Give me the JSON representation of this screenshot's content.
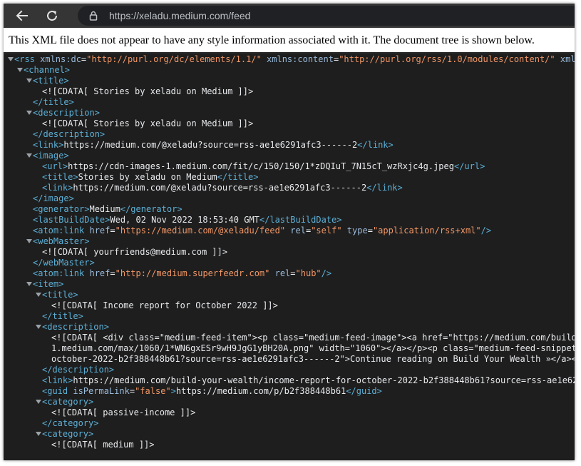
{
  "browser": {
    "url": "https://xeladu.medium.com/feed",
    "back_icon": "arrow-left",
    "reload_icon": "reload",
    "lock_icon": "lock"
  },
  "infobar": {
    "message": "This XML file does not appear to have any style information associated with it. The document tree is shown below."
  },
  "colors": {
    "tag": "#5db0d7",
    "attr_name": "#9bbbdc",
    "attr_value": "#f29766",
    "text": "#e8eaed",
    "background": "#1e1e1e"
  },
  "xml_lines": [
    {
      "indent": 0,
      "toggle": true,
      "segments": [
        [
          "tag",
          "<rss "
        ],
        [
          "attr",
          "xmlns:dc"
        ],
        [
          "text",
          "="
        ],
        [
          "val",
          "\"http://purl.org/dc/elements/1.1/\""
        ],
        [
          "text",
          " "
        ],
        [
          "attr",
          "xmlns:content"
        ],
        [
          "text",
          "="
        ],
        [
          "val",
          "\"http://purl.org/rss/1.0/modules/content/\""
        ],
        [
          "text",
          " "
        ],
        [
          "attr",
          "xmlns:atom"
        ]
      ]
    },
    {
      "indent": 1,
      "toggle": true,
      "segments": [
        [
          "tag",
          "<channel>"
        ]
      ]
    },
    {
      "indent": 2,
      "toggle": true,
      "segments": [
        [
          "tag",
          "<title>"
        ]
      ]
    },
    {
      "indent": 3,
      "toggle": false,
      "segments": [
        [
          "text",
          "<![CDATA[ Stories by xeladu on Medium ]]>"
        ]
      ]
    },
    {
      "indent": 2,
      "toggle": false,
      "segments": [
        [
          "tag",
          "</title>"
        ]
      ]
    },
    {
      "indent": 2,
      "toggle": true,
      "segments": [
        [
          "tag",
          "<description>"
        ]
      ]
    },
    {
      "indent": 3,
      "toggle": false,
      "segments": [
        [
          "text",
          "<![CDATA[ Stories by xeladu on Medium ]]>"
        ]
      ]
    },
    {
      "indent": 2,
      "toggle": false,
      "segments": [
        [
          "tag",
          "</description>"
        ]
      ]
    },
    {
      "indent": 2,
      "toggle": false,
      "segments": [
        [
          "tag",
          "<link>"
        ],
        [
          "text",
          "https://medium.com/@xeladu?source=rss-ae1e6291afc3------2"
        ],
        [
          "tag",
          "</link>"
        ]
      ]
    },
    {
      "indent": 2,
      "toggle": true,
      "segments": [
        [
          "tag",
          "<image>"
        ]
      ]
    },
    {
      "indent": 3,
      "toggle": false,
      "segments": [
        [
          "tag",
          "<url>"
        ],
        [
          "text",
          "https://cdn-images-1.medium.com/fit/c/150/150/1*zDQIuT_7N15cT_wzRxjc4g.jpeg"
        ],
        [
          "tag",
          "</url>"
        ]
      ]
    },
    {
      "indent": 3,
      "toggle": false,
      "segments": [
        [
          "tag",
          "<title>"
        ],
        [
          "text",
          "Stories by xeladu on Medium"
        ],
        [
          "tag",
          "</title>"
        ]
      ]
    },
    {
      "indent": 3,
      "toggle": false,
      "segments": [
        [
          "tag",
          "<link>"
        ],
        [
          "text",
          "https://medium.com/@xeladu?source=rss-ae1e6291afc3------2"
        ],
        [
          "tag",
          "</link>"
        ]
      ]
    },
    {
      "indent": 2,
      "toggle": false,
      "segments": [
        [
          "tag",
          "</image>"
        ]
      ]
    },
    {
      "indent": 2,
      "toggle": false,
      "segments": [
        [
          "tag",
          "<generator>"
        ],
        [
          "text",
          "Medium"
        ],
        [
          "tag",
          "</generator>"
        ]
      ]
    },
    {
      "indent": 2,
      "toggle": false,
      "segments": [
        [
          "tag",
          "<lastBuildDate>"
        ],
        [
          "text",
          "Wed, 02 Nov 2022 18:53:40 GMT"
        ],
        [
          "tag",
          "</lastBuildDate>"
        ]
      ]
    },
    {
      "indent": 2,
      "toggle": false,
      "segments": [
        [
          "tag",
          "<atom:link "
        ],
        [
          "attr",
          "href"
        ],
        [
          "text",
          "="
        ],
        [
          "val",
          "\"https://medium.com/@xeladu/feed\""
        ],
        [
          "text",
          " "
        ],
        [
          "attr",
          "rel"
        ],
        [
          "text",
          "="
        ],
        [
          "val",
          "\"self\""
        ],
        [
          "text",
          " "
        ],
        [
          "attr",
          "type"
        ],
        [
          "text",
          "="
        ],
        [
          "val",
          "\"application/rss+xml\""
        ],
        [
          "tag",
          "/>"
        ]
      ]
    },
    {
      "indent": 2,
      "toggle": true,
      "segments": [
        [
          "tag",
          "<webMaster>"
        ]
      ]
    },
    {
      "indent": 3,
      "toggle": false,
      "segments": [
        [
          "text",
          "<![CDATA[ yourfriends@medium.com ]]>"
        ]
      ]
    },
    {
      "indent": 2,
      "toggle": false,
      "segments": [
        [
          "tag",
          "</webMaster>"
        ]
      ]
    },
    {
      "indent": 2,
      "toggle": false,
      "segments": [
        [
          "tag",
          "<atom:link "
        ],
        [
          "attr",
          "href"
        ],
        [
          "text",
          "="
        ],
        [
          "val",
          "\"http://medium.superfeedr.com\""
        ],
        [
          "text",
          " "
        ],
        [
          "attr",
          "rel"
        ],
        [
          "text",
          "="
        ],
        [
          "val",
          "\"hub\""
        ],
        [
          "tag",
          "/>"
        ]
      ]
    },
    {
      "indent": 2,
      "toggle": true,
      "segments": [
        [
          "tag",
          "<item>"
        ]
      ]
    },
    {
      "indent": 3,
      "toggle": true,
      "segments": [
        [
          "tag",
          "<title>"
        ]
      ]
    },
    {
      "indent": 4,
      "toggle": false,
      "segments": [
        [
          "text",
          "<![CDATA[ Income report for October 2022 ]]>"
        ]
      ]
    },
    {
      "indent": 3,
      "toggle": false,
      "segments": [
        [
          "tag",
          "</title>"
        ]
      ]
    },
    {
      "indent": 3,
      "toggle": true,
      "segments": [
        [
          "tag",
          "<description>"
        ]
      ]
    },
    {
      "indent": 4,
      "toggle": false,
      "segments": [
        [
          "text",
          "<![CDATA[ <div class=\"medium-feed-item\"><p class=\"medium-feed-image\"><a href=\"https://medium.com/build-"
        ]
      ]
    },
    {
      "indent": 4,
      "toggle": false,
      "segments": [
        [
          "text",
          "1.medium.com/max/1060/1*WN6gxESr9wH9JgG1yBH20A.png\" width=\"1060\"></a></p><p class=\"medium-feed-snippet\""
        ]
      ]
    },
    {
      "indent": 4,
      "toggle": false,
      "segments": [
        [
          "text",
          "october-2022-b2f388448b61?source=rss-ae1e6291afc3------2\">Continue reading on Build Your Wealth »</a></"
        ]
      ]
    },
    {
      "indent": 3,
      "toggle": false,
      "segments": [
        [
          "tag",
          "</description>"
        ]
      ]
    },
    {
      "indent": 3,
      "toggle": false,
      "segments": [
        [
          "tag",
          "<link>"
        ],
        [
          "text",
          "https://medium.com/build-your-wealth/income-report-for-october-2022-b2f388448b61?source=rss-ae1e629"
        ]
      ]
    },
    {
      "indent": 3,
      "toggle": false,
      "segments": [
        [
          "tag",
          "<guid "
        ],
        [
          "attr",
          "isPermaLink"
        ],
        [
          "text",
          "="
        ],
        [
          "val",
          "\"false\""
        ],
        [
          "tag",
          ">"
        ],
        [
          "text",
          "https://medium.com/p/b2f388448b61"
        ],
        [
          "tag",
          "</guid>"
        ]
      ]
    },
    {
      "indent": 3,
      "toggle": true,
      "segments": [
        [
          "tag",
          "<category>"
        ]
      ]
    },
    {
      "indent": 4,
      "toggle": false,
      "segments": [
        [
          "text",
          "<![CDATA[ passive-income ]]>"
        ]
      ]
    },
    {
      "indent": 3,
      "toggle": false,
      "segments": [
        [
          "tag",
          "</category>"
        ]
      ]
    },
    {
      "indent": 3,
      "toggle": true,
      "segments": [
        [
          "tag",
          "<category>"
        ]
      ]
    },
    {
      "indent": 4,
      "toggle": false,
      "segments": [
        [
          "text",
          "<![CDATA[ medium ]]>"
        ]
      ]
    }
  ]
}
